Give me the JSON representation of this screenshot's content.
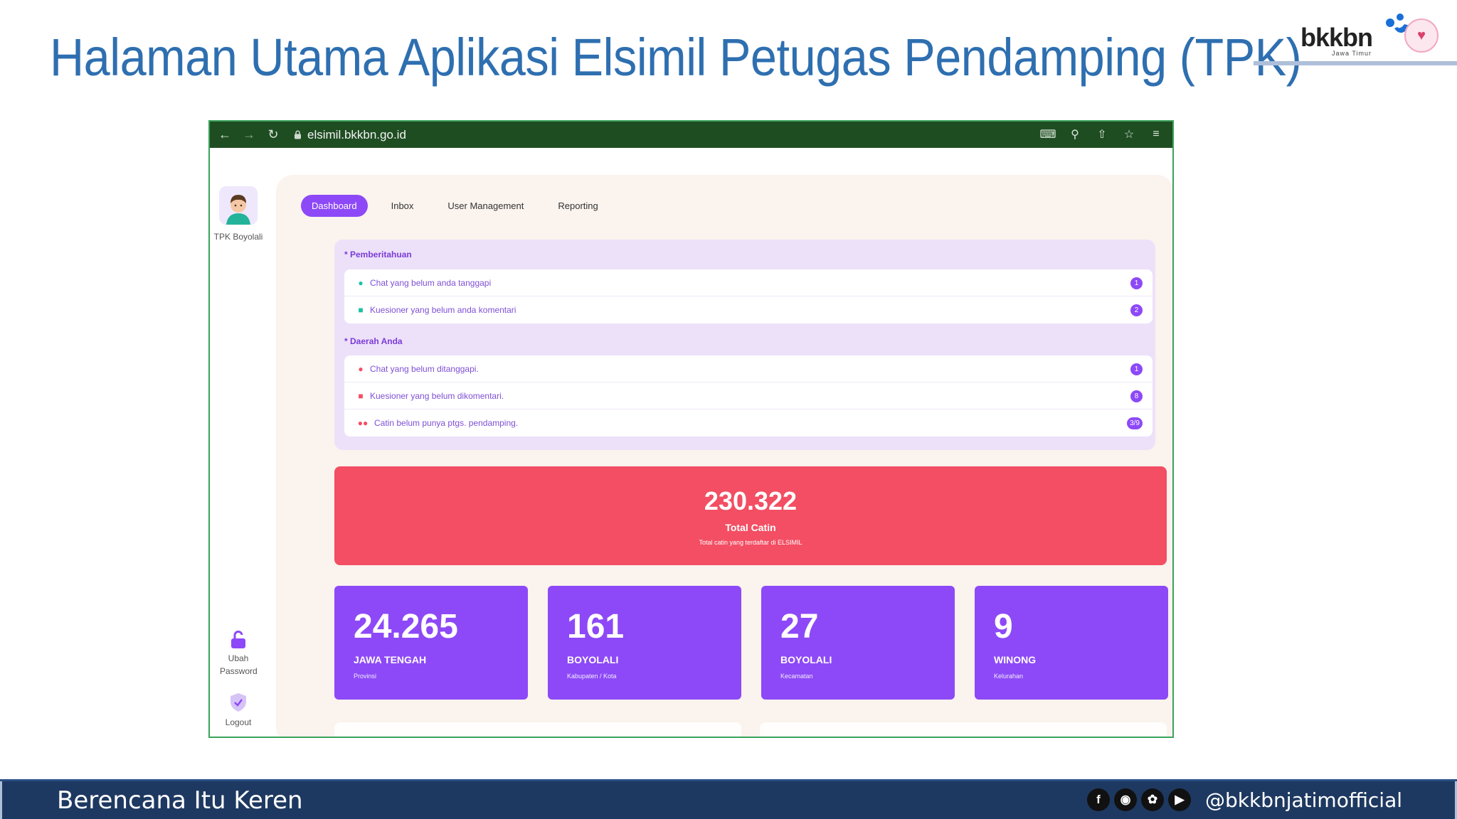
{
  "slide": {
    "title": "Halaman Utama Aplikasi Elsimil Petugas Pendamping (TPK)",
    "logo": {
      "wordmark": "bkkbn",
      "region": "Jawa Timur"
    }
  },
  "browser": {
    "url": "elsimil.bkkbn.go.id",
    "left_icons": [
      "back-arrow-icon",
      "forward-arrow-icon",
      "reload-icon"
    ],
    "right_icons": [
      "translate-icon",
      "zoom-icon",
      "share-icon",
      "bookmark-star-icon",
      "reading-list-icon"
    ]
  },
  "app": {
    "sidebar": {
      "user_label": "TPK Boyolali",
      "change_password_label": "Ubah Password",
      "logout_label": "Logout"
    },
    "nav": {
      "tabs": [
        {
          "label": "Dashboard",
          "active": true
        },
        {
          "label": "Inbox",
          "active": false
        },
        {
          "label": "User Management",
          "active": false
        },
        {
          "label": "Reporting",
          "active": false
        }
      ]
    },
    "notifications": {
      "pemberitahuan_title": "* Pemberitahuan",
      "pemberitahuan_items": [
        {
          "text": "Chat yang belum anda tanggapi",
          "count": "1",
          "icon": "chat-bubble-icon",
          "color": "#1fbfa5"
        },
        {
          "text": "Kuesioner yang belum anda komentari",
          "count": "2",
          "icon": "clipboard-icon",
          "color": "#1fbfa5"
        }
      ],
      "daerah_title": "* Daerah Anda",
      "daerah_items": [
        {
          "text": "Chat yang belum ditanggapi.",
          "count": "1",
          "icon": "chat-bubble-icon",
          "color": "#f34e63"
        },
        {
          "text": "Kuesioner yang belum dikomentari.",
          "count": "8",
          "icon": "clipboard-icon",
          "color": "#f34e63"
        },
        {
          "text": "Catin belum punya ptgs. pendamping.",
          "count": "3/9",
          "icon": "users-icon",
          "color": "#f34e63"
        }
      ]
    },
    "total": {
      "value": "230.322",
      "label": "Total Catin",
      "description": "Total catin yang terdaftar di ELSIMIL"
    },
    "cards": [
      {
        "value": "24.265",
        "name": "JAWA TENGAH",
        "level": "Provinsi"
      },
      {
        "value": "161",
        "name": "BOYOLALI",
        "level": "Kabupaten / Kota"
      },
      {
        "value": "27",
        "name": "BOYOLALI",
        "level": "Kecamatan"
      },
      {
        "value": "9",
        "name": "WINONG",
        "level": "Kelurahan"
      }
    ]
  },
  "footer": {
    "tagline": "Berencana Itu Keren",
    "social_icons": [
      "facebook-icon",
      "instagram-icon",
      "twitter-icon",
      "youtube-icon"
    ],
    "handle": "@bkkbnjatimofficial"
  },
  "colors": {
    "title_blue": "#2e6fb0",
    "browser_bar": "#1f4d22",
    "accent_purple": "#8d49f7",
    "total_red": "#f34e63",
    "footer_navy": "#1e3961"
  }
}
